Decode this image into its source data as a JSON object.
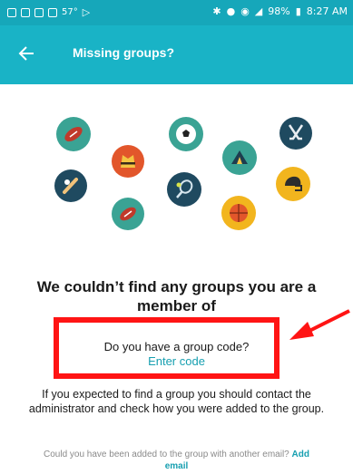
{
  "status_bar": {
    "notif_text": "57°",
    "battery": "98%",
    "time": "8:27 AM"
  },
  "app_bar": {
    "title": "Missing groups?",
    "back_icon": "arrow-back-icon"
  },
  "illustration": {
    "icons": [
      "football-icon",
      "judo-icon",
      "soccer-ball-icon",
      "hockey-sticks-icon",
      "baseball-icon",
      "tennis-icon",
      "tent-icon",
      "football-helmet-icon",
      "football-icon",
      "basketball-icon"
    ]
  },
  "empty_state": {
    "headline": "We couldn’t find any groups you are a member of",
    "code_question": "Do you have a group code?",
    "enter_code_link": "Enter code",
    "explanation": "If you expected to find a group you should contact the administrator and check how you were added to the group.",
    "other_email_text": "Could you have been added to the group with another email?",
    "add_email_link": "Add email"
  },
  "colors": {
    "accent": "#19b3c6",
    "link": "#169fb0",
    "highlight": "#ff1414"
  }
}
